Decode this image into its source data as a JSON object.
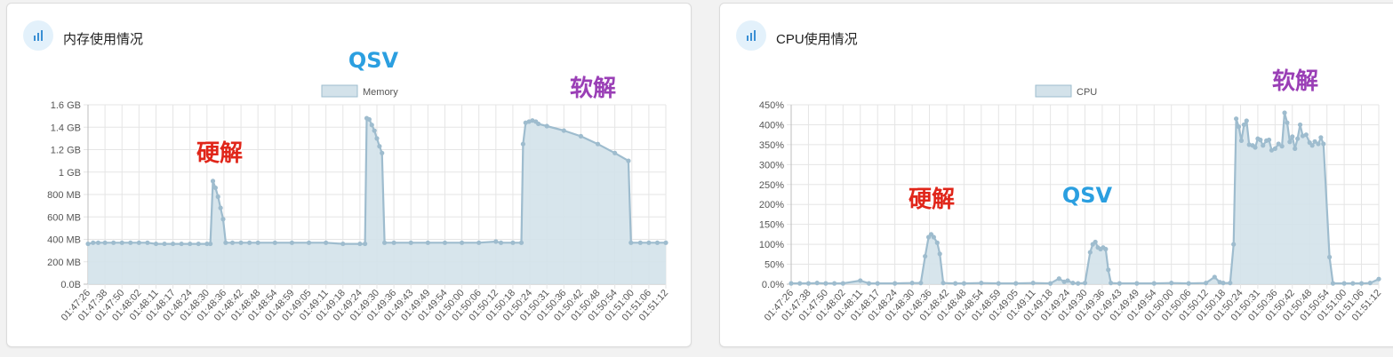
{
  "cards": {
    "memory": {
      "title": "内存使用情况"
    },
    "cpu": {
      "title": "CPU使用情况"
    }
  },
  "chart_data": [
    {
      "type": "area",
      "legend": [
        "Memory"
      ],
      "legend_position": "top",
      "grid": true,
      "x_ticks": [
        "01:47:26",
        "01:47:38",
        "01:47:50",
        "01:48:02",
        "01:48:11",
        "01:48:17",
        "01:48:24",
        "01:48:30",
        "01:48:36",
        "01:48:42",
        "01:48:48",
        "01:48:54",
        "01:48:59",
        "01:49:05",
        "01:49:11",
        "01:49:18",
        "01:49:24",
        "01:49:30",
        "01:49:36",
        "01:49:43",
        "01:49:49",
        "01:49:54",
        "01:50:00",
        "01:50:06",
        "01:50:12",
        "01:50:18",
        "01:50:24",
        "01:50:31",
        "01:50:36",
        "01:50:42",
        "01:50:48",
        "01:50:54",
        "01:51:00",
        "01:51:06",
        "01:51:12"
      ],
      "y_ticks": [
        "0.0B",
        "200 MB",
        "400 MB",
        "600 MB",
        "800 MB",
        "1 GB",
        "1.2 GB",
        "1.4 GB",
        "1.6 GB"
      ],
      "ylim": [
        0,
        1.6
      ],
      "y_unit": "GB",
      "series": [
        {
          "name": "Memory",
          "color": "#9ebcce",
          "fill": "#d3e2ea",
          "points": [
            [
              0.0,
              0.36
            ],
            [
              0.3,
              0.37
            ],
            [
              0.6,
              0.37
            ],
            [
              1,
              0.37
            ],
            [
              1.5,
              0.37
            ],
            [
              2,
              0.37
            ],
            [
              2.5,
              0.37
            ],
            [
              3,
              0.37
            ],
            [
              3.5,
              0.37
            ],
            [
              4,
              0.36
            ],
            [
              4.5,
              0.36
            ],
            [
              5,
              0.36
            ],
            [
              5.5,
              0.36
            ],
            [
              6,
              0.36
            ],
            [
              6.5,
              0.36
            ],
            [
              7,
              0.36
            ],
            [
              7.2,
              0.36
            ],
            [
              7.35,
              0.92
            ],
            [
              7.5,
              0.86
            ],
            [
              7.65,
              0.78
            ],
            [
              7.8,
              0.68
            ],
            [
              7.95,
              0.58
            ],
            [
              8.1,
              0.37
            ],
            [
              8.5,
              0.37
            ],
            [
              9,
              0.37
            ],
            [
              9.5,
              0.37
            ],
            [
              10,
              0.37
            ],
            [
              11,
              0.37
            ],
            [
              12,
              0.37
            ],
            [
              13,
              0.37
            ],
            [
              14,
              0.37
            ],
            [
              15,
              0.36
            ],
            [
              16,
              0.36
            ],
            [
              16.3,
              0.36
            ],
            [
              16.4,
              1.48
            ],
            [
              16.55,
              1.47
            ],
            [
              16.7,
              1.42
            ],
            [
              16.85,
              1.37
            ],
            [
              17,
              1.3
            ],
            [
              17.15,
              1.23
            ],
            [
              17.3,
              1.17
            ],
            [
              17.45,
              0.37
            ],
            [
              18,
              0.37
            ],
            [
              19,
              0.37
            ],
            [
              20,
              0.37
            ],
            [
              21,
              0.37
            ],
            [
              22,
              0.37
            ],
            [
              23,
              0.37
            ],
            [
              24,
              0.38
            ],
            [
              24.3,
              0.37
            ],
            [
              25,
              0.37
            ],
            [
              25.5,
              0.37
            ],
            [
              25.6,
              1.25
            ],
            [
              25.75,
              1.44
            ],
            [
              25.95,
              1.45
            ],
            [
              26.15,
              1.46
            ],
            [
              26.35,
              1.45
            ],
            [
              26.5,
              1.43
            ],
            [
              27,
              1.41
            ],
            [
              28,
              1.37
            ],
            [
              29,
              1.32
            ],
            [
              30,
              1.25
            ],
            [
              31,
              1.17
            ],
            [
              31.8,
              1.1
            ],
            [
              31.95,
              0.37
            ],
            [
              32.5,
              0.37
            ],
            [
              33,
              0.37
            ],
            [
              33.5,
              0.37
            ],
            [
              34,
              0.37
            ]
          ]
        }
      ],
      "annotations": [
        {
          "text": "QSV",
          "color": "#2b9fe0"
        },
        {
          "text": "软解",
          "color": "#9a3fb6"
        },
        {
          "text": "硬解",
          "color": "#e0261a"
        }
      ]
    },
    {
      "type": "area",
      "legend": [
        "CPU"
      ],
      "legend_position": "top",
      "grid": true,
      "x_ticks": [
        "01:47:26",
        "01:47:38",
        "01:47:50",
        "01:48:02",
        "01:48:11",
        "01:48:17",
        "01:48:24",
        "01:48:30",
        "01:48:36",
        "01:48:42",
        "01:48:48",
        "01:48:54",
        "01:48:59",
        "01:49:05",
        "01:49:11",
        "01:49:18",
        "01:49:24",
        "01:49:30",
        "01:49:36",
        "01:49:43",
        "01:49:49",
        "01:49:54",
        "01:50:00",
        "01:50:06",
        "01:50:12",
        "01:50:18",
        "01:50:24",
        "01:50:31",
        "01:50:36",
        "01:50:42",
        "01:50:48",
        "01:50:54",
        "01:51:00",
        "01:51:06",
        "01:51:12"
      ],
      "y_ticks": [
        "0.0%",
        "50%",
        "100%",
        "150%",
        "200%",
        "250%",
        "300%",
        "350%",
        "400%",
        "450%"
      ],
      "ylim": [
        0,
        450
      ],
      "y_unit": "%",
      "series": [
        {
          "name": "CPU",
          "color": "#9ebcce",
          "fill": "#d3e2ea",
          "points": [
            [
              0,
              2
            ],
            [
              0.5,
              2
            ],
            [
              1,
              2
            ],
            [
              1.5,
              3
            ],
            [
              2,
              2
            ],
            [
              2.5,
              2
            ],
            [
              3,
              2
            ],
            [
              4,
              9
            ],
            [
              4.5,
              2
            ],
            [
              5,
              2
            ],
            [
              6,
              2
            ],
            [
              7,
              3
            ],
            [
              7.5,
              3
            ],
            [
              7.75,
              70
            ],
            [
              7.95,
              118
            ],
            [
              8.1,
              125
            ],
            [
              8.25,
              118
            ],
            [
              8.45,
              104
            ],
            [
              8.6,
              76
            ],
            [
              8.8,
              3
            ],
            [
              9.5,
              2
            ],
            [
              10,
              2
            ],
            [
              11,
              3
            ],
            [
              12,
              2
            ],
            [
              13,
              2
            ],
            [
              14,
              3
            ],
            [
              15,
              2
            ],
            [
              15.5,
              14
            ],
            [
              15.8,
              6
            ],
            [
              16,
              9
            ],
            [
              16.3,
              3
            ],
            [
              16.6,
              2
            ],
            [
              17,
              3
            ],
            [
              17.3,
              80
            ],
            [
              17.45,
              100
            ],
            [
              17.6,
              106
            ],
            [
              17.75,
              92
            ],
            [
              17.9,
              88
            ],
            [
              18.05,
              92
            ],
            [
              18.2,
              88
            ],
            [
              18.35,
              36
            ],
            [
              18.5,
              3
            ],
            [
              19,
              2
            ],
            [
              20,
              2
            ],
            [
              21,
              2
            ],
            [
              22,
              3
            ],
            [
              23,
              2
            ],
            [
              24,
              3
            ],
            [
              24.5,
              18
            ],
            [
              24.8,
              5
            ],
            [
              25,
              3
            ],
            [
              25.4,
              3
            ],
            [
              25.6,
              100
            ],
            [
              25.75,
              415
            ],
            [
              25.9,
              395
            ],
            [
              26.05,
              360
            ],
            [
              26.2,
              400
            ],
            [
              26.35,
              410
            ],
            [
              26.5,
              350
            ],
            [
              26.7,
              348
            ],
            [
              26.85,
              343
            ],
            [
              27,
              365
            ],
            [
              27.15,
              362
            ],
            [
              27.3,
              348
            ],
            [
              27.5,
              360
            ],
            [
              27.65,
              362
            ],
            [
              27.8,
              336
            ],
            [
              28,
              340
            ],
            [
              28.2,
              352
            ],
            [
              28.4,
              346
            ],
            [
              28.55,
              430
            ],
            [
              28.7,
              405
            ],
            [
              28.85,
              357
            ],
            [
              29,
              370
            ],
            [
              29.15,
              340
            ],
            [
              29.3,
              365
            ],
            [
              29.45,
              400
            ],
            [
              29.6,
              372
            ],
            [
              29.8,
              375
            ],
            [
              30,
              355
            ],
            [
              30.15,
              348
            ],
            [
              30.3,
              358
            ],
            [
              30.5,
              352
            ],
            [
              30.65,
              368
            ],
            [
              30.8,
              352
            ],
            [
              31.15,
              68
            ],
            [
              31.35,
              2
            ],
            [
              32,
              2
            ],
            [
              32.5,
              2
            ],
            [
              33,
              2
            ],
            [
              33.5,
              3
            ],
            [
              34,
              13
            ]
          ]
        }
      ],
      "annotations": [
        {
          "text": "软解",
          "color": "#9a3fb6"
        },
        {
          "text": "硬解",
          "color": "#e0261a"
        },
        {
          "text": "QSV",
          "color": "#2b9fe0"
        }
      ]
    }
  ]
}
